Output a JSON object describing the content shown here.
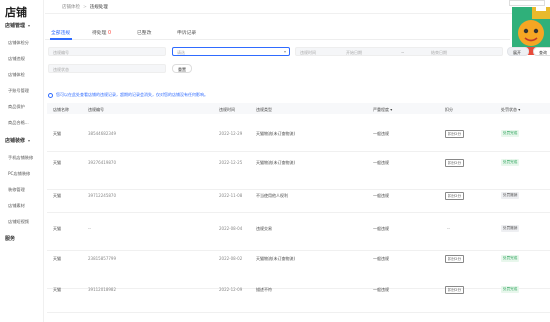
{
  "sidebar": {
    "logo": "店铺",
    "group1": "店铺管理",
    "items1": [
      "店铺体检分",
      "店铺违规",
      "店铺体检",
      "子账号管理",
      "商品保护",
      "商品合格..."
    ],
    "group2": "店铺装修",
    "items2": [
      "手机店铺装修",
      "PC店铺装修",
      "装修管理",
      "店铺素材",
      "店铺短视频"
    ],
    "group3": "服务"
  },
  "topbar": {
    "breadcrumb_parent": "店铺体检",
    "breadcrumb_current": "违规处理"
  },
  "tabs": {
    "all": "全部违规",
    "pending_label": "待处理",
    "pending_count": "0",
    "rectified": "已整改",
    "appeal": "申诉记录"
  },
  "filters": {
    "violation_id_placeholder": "违规编号",
    "type_placeholder": "请选",
    "time_label": "违规时间",
    "start_placeholder": "开始日期",
    "range_sep": "~",
    "end_placeholder": "结束日期",
    "expand_button": "展开",
    "query_button": "查询",
    "status_placeholder": "违规状态",
    "reset_button": "重置"
  },
  "notice": "您可以在此处查看店铺的违规记录，超期的记录会消失，仅对您的店铺没有任何影响。",
  "table": {
    "headers": [
      "店铺名称",
      "违规编号",
      "违规时间",
      "违规类型",
      "严重程度",
      "扣分",
      "处罚状态"
    ],
    "rows": [
      {
        "shop": "天猫",
        "id": "38544682349",
        "time": "2022-12-29",
        "type": "天猫物流(未订查物流)",
        "level": "一般违规",
        "score": "扣分2分",
        "status": "处罚完成",
        "status_kind": "ok"
      },
      {
        "shop": "天猫",
        "id": "39276419870",
        "time": "2022-12-25",
        "type": "天猫物流(未订查物流)",
        "level": "一般违规",
        "score": "扣分2分",
        "status": "处罚完成",
        "status_kind": "ok"
      },
      {
        "shop": "天猫",
        "id": "39712245870",
        "time": "2022-11-08",
        "type": "不当使用他人权利",
        "level": "一般违规",
        "score": "扣分2分",
        "status": "处罚撤销",
        "status_kind": "grey"
      },
      {
        "shop": "天猫",
        "id": "--",
        "time": "2022-08-04",
        "type": "违规交易",
        "level": "一般违规",
        "score": "--",
        "status": "处罚撤销",
        "status_kind": "grey"
      },
      {
        "shop": "天猫",
        "id": "23815857799",
        "time": "2022-08-02",
        "type": "天猫物流(未订查物流)",
        "level": "一般违规",
        "score": "扣分2分",
        "status": "处罚完成",
        "status_kind": "ok"
      },
      {
        "shop": "天猫",
        "id": "39112018982",
        "time": "2022-12-09",
        "type": "描述不符",
        "level": "一般违规",
        "score": "扣分2分",
        "status": "处罚完成",
        "status_kind": "ok"
      }
    ]
  },
  "colors": {
    "accent": "#2f6bff",
    "ok": "#2aa35a",
    "danger": "#ff3b30"
  }
}
